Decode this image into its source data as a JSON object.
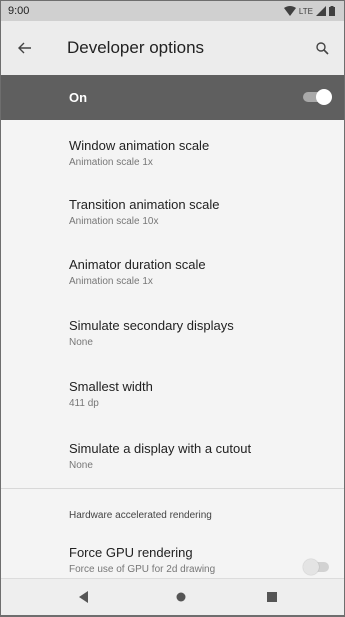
{
  "status_bar": {
    "time": "9:00",
    "network_label": "LTE"
  },
  "app_bar": {
    "title": "Developer options"
  },
  "master_switch": {
    "label": "On",
    "enabled": true
  },
  "settings": [
    {
      "title": "Window animation scale",
      "summary": "Animation scale 1x"
    },
    {
      "title": "Transition animation scale",
      "summary": "Animation scale 10x"
    },
    {
      "title": "Animator duration scale",
      "summary": "Animation scale 1x"
    },
    {
      "title": "Simulate secondary displays",
      "summary": "None"
    },
    {
      "title": "Smallest width",
      "summary": "411 dp"
    },
    {
      "title": "Simulate a display with a cutout",
      "summary": "None"
    }
  ],
  "hardware_section": {
    "header": "Hardware accelerated rendering",
    "items": [
      {
        "title": "Force GPU rendering",
        "summary": "Force use of GPU for 2d drawing",
        "enabled": false
      }
    ]
  },
  "icons": {
    "back": "arrow-back-icon",
    "search": "search-icon",
    "wifi": "wifi-icon",
    "signal": "signal-icon",
    "battery": "battery-icon",
    "nav_back": "nav-back-icon",
    "nav_home": "nav-home-icon",
    "nav_recents": "nav-recents-icon"
  },
  "colors": {
    "master_bar": "#5f5f5f",
    "status_bar": "#d0d0d0",
    "app_bar": "#ececec",
    "background": "#f4f4f4"
  }
}
